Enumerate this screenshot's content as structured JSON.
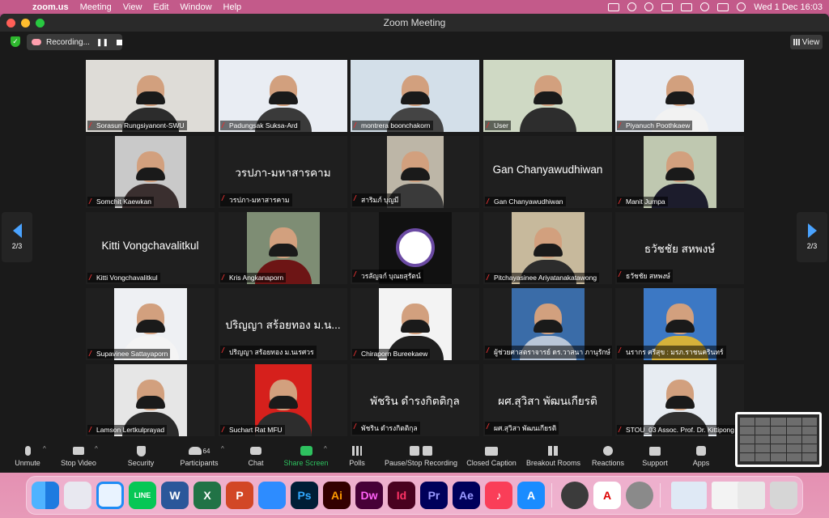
{
  "menubar": {
    "app": "zoom.us",
    "items": [
      "Meeting",
      "View",
      "Edit",
      "Window",
      "Help"
    ],
    "clock": "Wed 1 Dec  16:03"
  },
  "window": {
    "title": "Zoom Meeting"
  },
  "recording": {
    "label": "Recording..."
  },
  "view_label": "View",
  "page_indicator": "2/3",
  "tiles": [
    {
      "name": "Sorasun Rungsiyanont-SWU",
      "big": ""
    },
    {
      "name": "Padungsak Suksa-Ard",
      "big": ""
    },
    {
      "name": "montrera boonchakorn",
      "big": ""
    },
    {
      "name": "User",
      "big": ""
    },
    {
      "name": "Piyanuch Poothkaew",
      "big": ""
    },
    {
      "name": "Somchit Kaewkan",
      "big": ""
    },
    {
      "name": "วรปภา-มหาสารคาม",
      "big": "วรปภา-มหาสารคาม"
    },
    {
      "name": "สาริมภ์ บุญมี",
      "big": ""
    },
    {
      "name": "Gan Chanyawudhiwan",
      "big": "Gan Chanyawudhiwan"
    },
    {
      "name": "Manit Jumpa",
      "big": ""
    },
    {
      "name": "Kitti Vongchavalitkul",
      "big": "Kitti Vongchavalitkul"
    },
    {
      "name": "Kris Angkanaporn",
      "big": ""
    },
    {
      "name": "วรลัญจก์ บุณยสุรัตน์",
      "big": ""
    },
    {
      "name": "Pitchayasinee Ariyatanakatawong",
      "big": ""
    },
    {
      "name": "ธวัชชัย สหพงษ์",
      "big": "ธวัชชัย สหพงษ์"
    },
    {
      "name": "Supavinee Sattayaporn",
      "big": ""
    },
    {
      "name": "ปริญญา สร้อยทอง ม.นเรศวร",
      "big": "ปริญญา สร้อยทอง ม.น..."
    },
    {
      "name": "Chiraporn Bureekaew",
      "big": ""
    },
    {
      "name": "ผู้ช่วยศาสตราจารย์ ดร.วาสนา ภานุรักษ์",
      "big": ""
    },
    {
      "name": "นรากร ศรีสุข : มรภ.ราชนครินทร์",
      "big": ""
    },
    {
      "name": "Lamson Lertkulprayad",
      "big": ""
    },
    {
      "name": "Suchart Rat MFU",
      "big": ""
    },
    {
      "name": "พัชริน ดำรงกิตติกุล",
      "big": "พัชริน ดำรงกิตติกุล"
    },
    {
      "name": "ผศ.สุวิสา พัฒนเกียรติ",
      "big": "ผศ.สุวิสา พัฒนเกียรติ"
    },
    {
      "name": "STOU_03 Assoc. Prof. Dr. Kittipong",
      "big": ""
    }
  ],
  "toolbar": {
    "unmute": "Unmute",
    "stop_video": "Stop Video",
    "security": "Security",
    "participants": "Participants",
    "participants_count": "64",
    "chat": "Chat",
    "share_screen": "Share Screen",
    "polls": "Polls",
    "recording": "Pause/Stop Recording",
    "closed_caption": "Closed Caption",
    "breakout": "Breakout Rooms",
    "reactions": "Reactions",
    "support": "Support",
    "apps": "Apps"
  },
  "dock": {
    "apps": [
      "Finder",
      "Launchpad",
      "Safari",
      "LINE",
      "Word",
      "Excel",
      "PowerPoint",
      "Zoom",
      "Photoshop",
      "Illustrator",
      "Dreamweaver",
      "InDesign",
      "Premiere Pro",
      "After Effects",
      "Music",
      "App Store",
      "QuickTime",
      "Acrobat",
      "System Preferences"
    ],
    "glyphs": {
      "line": "LINE",
      "word": "W",
      "excel": "X",
      "ppt": "P",
      "ps": "Ps",
      "ai": "Ai",
      "dw": "Dw",
      "id": "Id",
      "pr": "Pr",
      "ae": "Ae",
      "music": "♪",
      "appstore": "A",
      "acrobat": "A"
    }
  },
  "colors": {
    "share_green": "#2ec15f",
    "mic_red": "#e03030",
    "tile_bg": "#1f1f1f"
  }
}
